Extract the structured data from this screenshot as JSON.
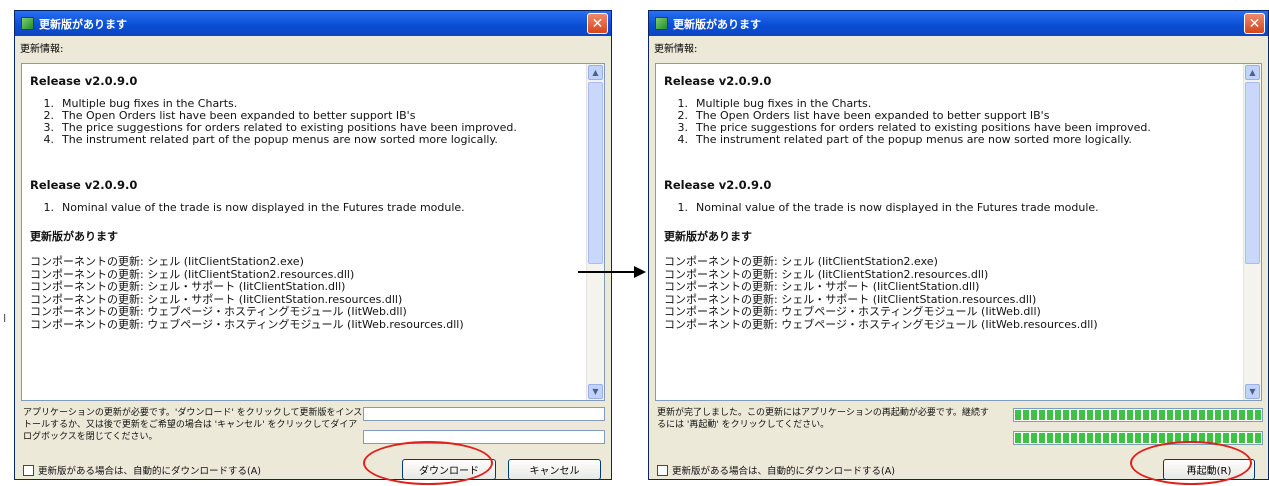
{
  "dialog": {
    "title": "更新版があります",
    "info_label": "更新情報:",
    "close_glyph": "✕"
  },
  "release_notes": {
    "release1_title": "Release v2.0.9.0",
    "release1_items": [
      "Multiple bug fixes in the Charts.",
      "The Open Orders list have been expanded to better support IB's",
      "The price suggestions for orders related to existing positions have been improved.",
      "The instrument related part of the popup menus are now sorted more logically."
    ],
    "release2_title": "Release v2.0.9.0",
    "release2_items": [
      "Nominal value of the trade is now displayed in the Futures trade module."
    ],
    "update_title": "更新版があります",
    "components": [
      "コンポーネントの更新: シェル (IitClientStation2.exe)",
      "コンポーネントの更新: シェル (IitClientStation2.resources.dll)",
      "コンポーネントの更新: シェル・サポート (IitClientStation.dll)",
      "コンポーネントの更新: シェル・サポート (IitClientStation.resources.dll)",
      "コンポーネントの更新: ウェブページ・ホスティングモジュール (IitWeb.dll)",
      "コンポーネントの更新: ウェブページ・ホスティングモジュール (IitWeb.resources.dll)"
    ]
  },
  "before": {
    "message": "アプリケーションの更新が必要です。'ダウンロード' をクリックして更新版をインストールするか、又は後で更新をご希望の場合は 'キャンセル' をクリックしてダイアログボックスを閉じてください。",
    "auto_download_label": "更新版がある場合は、自動的にダウンロードする(A)",
    "download_button": "ダウンロード",
    "cancel_button": "キャンセル"
  },
  "after": {
    "message": "更新が完了しました。この更新にはアプリケーションの再起動が必要です。継続するには '再起動' をクリックしてください。",
    "auto_download_label": "更新版がある場合は、自動的にダウンロードする(A)",
    "restart_button": "再起動(R)",
    "progress_1": 1.0,
    "progress_2": 1.0
  },
  "icons": {
    "scroll_up": "▲",
    "scroll_down": "▼"
  },
  "colors": {
    "title_bar": "#0a4fd6",
    "highlight": "#e0201c",
    "progress_fill": "#3fc241"
  }
}
